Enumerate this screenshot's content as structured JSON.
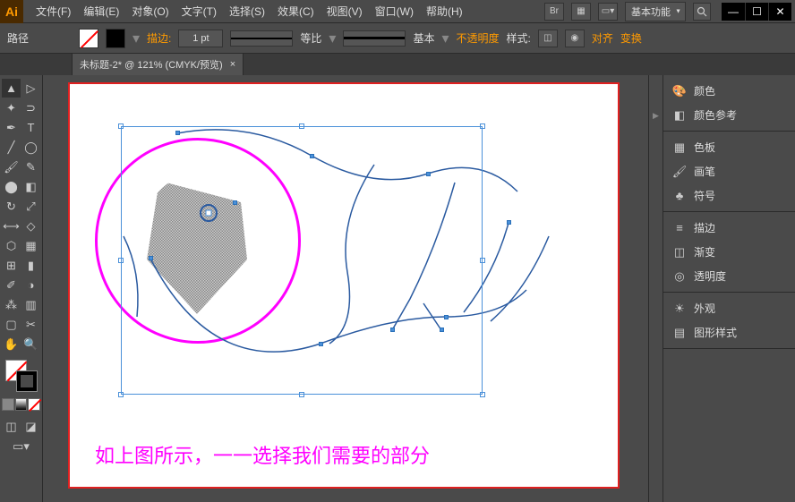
{
  "menu": [
    "文件(F)",
    "编辑(E)",
    "对象(O)",
    "文字(T)",
    "选择(S)",
    "效果(C)",
    "视图(V)",
    "窗口(W)",
    "帮助(H)"
  ],
  "titlebar": {
    "logo": "Ai",
    "workspace": "基本功能"
  },
  "controlbar": {
    "context": "路径",
    "stroke_label": "描边:",
    "stroke_pt": "1 pt",
    "profile1": "等比",
    "profile2": "基本",
    "opacity": "不透明度",
    "style": "样式:",
    "align": "对齐",
    "transform": "变换"
  },
  "tab": {
    "title": "未标题-2* @ 121% (CMYK/预览)",
    "close": "×"
  },
  "caption": "如上图所示，一一选择我们需要的部分",
  "panels": {
    "g1": [
      {
        "icon": "🎨",
        "label": "颜色"
      },
      {
        "icon": "◧",
        "label": "颜色参考"
      }
    ],
    "g2": [
      {
        "icon": "▦",
        "label": "色板"
      },
      {
        "icon": "🖌",
        "label": "画笔"
      },
      {
        "icon": "♣",
        "label": "符号"
      }
    ],
    "g3": [
      {
        "icon": "≡",
        "label": "描边"
      },
      {
        "icon": "◫",
        "label": "渐变"
      },
      {
        "icon": "◎",
        "label": "透明度"
      }
    ],
    "g4": [
      {
        "icon": "☀",
        "label": "外观"
      },
      {
        "icon": "▤",
        "label": "图形样式"
      }
    ]
  }
}
